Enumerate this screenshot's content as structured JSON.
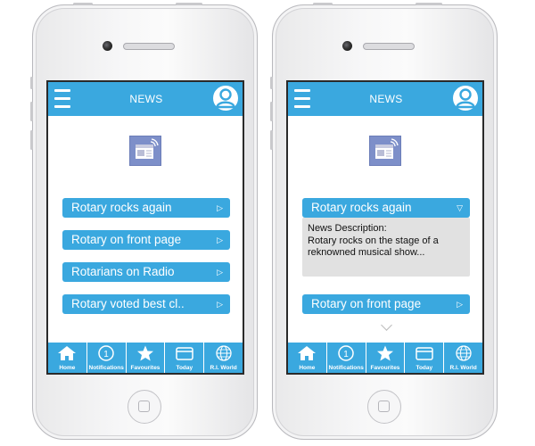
{
  "left_screen": {
    "header": {
      "title": "NEWS",
      "menu_icon": "hamburger-menu-icon",
      "profile_icon": "user-profile-icon"
    },
    "news_items": [
      {
        "label": "Rotary rocks again"
      },
      {
        "label": "Rotary on front page"
      },
      {
        "label": "Rotarians on Radio"
      },
      {
        "label": "Rotary voted best cl.."
      }
    ],
    "arrow": "▷",
    "tabs": [
      {
        "label": "Home",
        "icon": "home-icon"
      },
      {
        "label": "Notifications",
        "icon": "notifications-icon",
        "badge": "1"
      },
      {
        "label": "Favourites",
        "icon": "star-icon"
      },
      {
        "label": "Today",
        "icon": "card-icon"
      },
      {
        "label": "R.I. World",
        "icon": "globe-icon"
      }
    ]
  },
  "right_screen": {
    "header": {
      "title": "NEWS",
      "menu_icon": "hamburger-menu-icon",
      "profile_icon": "user-profile-icon"
    },
    "expanded_item": {
      "label": "Rotary rocks again",
      "arrow": "▽"
    },
    "description": {
      "heading": "News Description:",
      "text": "Rotary rocks on the stage of a reknowned musical show..."
    },
    "next_item": {
      "label": "Rotary on front page",
      "arrow": "▷"
    },
    "tabs": [
      {
        "label": "Home",
        "icon": "home-icon"
      },
      {
        "label": "Notifications",
        "icon": "notifications-icon",
        "badge": "1"
      },
      {
        "label": "Favourites",
        "icon": "star-icon"
      },
      {
        "label": "Today",
        "icon": "card-icon"
      },
      {
        "label": "R.I. World",
        "icon": "globe-icon"
      }
    ]
  },
  "colors": {
    "accent": "#3aa8df",
    "thumbnail": "#7d8fc9",
    "description_bg": "#e1e1e1"
  }
}
